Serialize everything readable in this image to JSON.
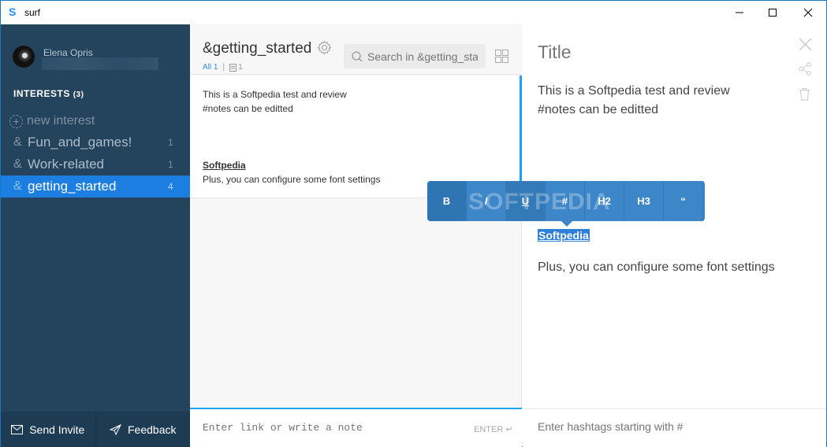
{
  "window": {
    "title": "surf",
    "logo": "S",
    "controls": {
      "minimize": "minimize-icon",
      "maximize": "maximize-icon",
      "close": "close-icon"
    }
  },
  "sidebar": {
    "user": {
      "name": "Elena Opris"
    },
    "section_title": "INTERESTS",
    "section_count": "(3)",
    "new_interest": "new interest",
    "interests": [
      {
        "prefix": "&",
        "label": "Fun_and_games!",
        "count": "1",
        "active": false
      },
      {
        "prefix": "&",
        "label": "Work-related",
        "count": "1",
        "active": false
      },
      {
        "prefix": "&",
        "label": "getting_started",
        "count": "4",
        "active": true
      }
    ],
    "footer": {
      "send_invite": "Send Invite",
      "feedback": "Feedback"
    }
  },
  "middle": {
    "title": "&getting_started",
    "filter_all": "All 1",
    "filter_sep": "|",
    "filter_notes": "1",
    "search_placeholder": "Search in &getting_started",
    "note": {
      "line1": "This is a Softpedia test and review",
      "line2": "#notes can be editted",
      "bold": "Softpedia",
      "line3": "Plus, you can configure some font settings"
    },
    "compose_placeholder": "Enter link or write a note",
    "enter_label": "ENTER ↵"
  },
  "editor": {
    "title_placeholder": "Title",
    "line1": "This is a Softpedia test and review",
    "line2": "#notes can be editted",
    "selected": "Softpedia",
    "line3": "Plus, you can configure some font settings",
    "hashtags_placeholder": "Enter hashtags starting with #"
  },
  "format_toolbar": {
    "buttons": [
      "B",
      "I",
      "U",
      "#",
      "H2",
      "H3",
      "“"
    ],
    "watermark": "SOFTPEDIA"
  },
  "colors": {
    "sidebar_bg": "#24435d",
    "active_item": "#1b7ee0",
    "accent": "#1da1f2",
    "toolbar": "#3d87c9"
  }
}
